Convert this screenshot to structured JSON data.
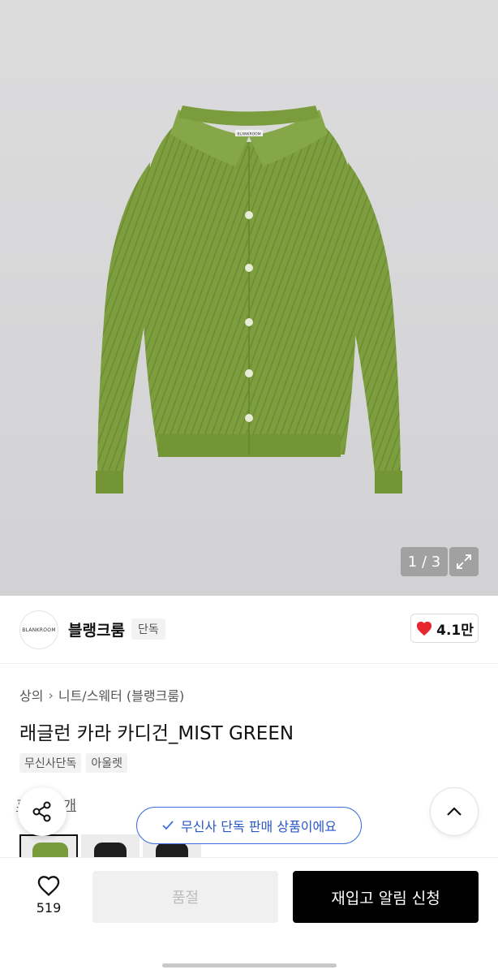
{
  "image_viewer": {
    "counter": "1 / 3",
    "expand_icon": "expand-arrows-icon",
    "garment_label": "BLANKROOM",
    "colors": {
      "background": "#d7d7d9",
      "garment": "#7a9b3c"
    }
  },
  "brand": {
    "logo_text": "BLANKROOM",
    "name": "블랭크룸",
    "tag": "단독",
    "likes": "4.1만",
    "like_icon": "heart-filled-icon",
    "like_color": "#e8262f"
  },
  "product": {
    "breadcrumb": [
      "상의",
      "니트/스웨터 (블랭크룸)"
    ],
    "title": "래글런 카라 카디건_MIST GREEN",
    "tags": [
      "무신사단독",
      "아울렛"
    ],
    "review_text": "후기 63개"
  },
  "floating": {
    "share_icon": "share-icon",
    "scroll_top_icon": "chevron-up-icon",
    "toast_icon": "check-icon",
    "toast_text": "무신사 단독 판매 상품이에요",
    "toast_color": "#3d6fe0"
  },
  "thumbnails": [
    {
      "label": "MIST GREEN",
      "color": "#7a9b3c"
    },
    {
      "label": "BLACK",
      "color": "#1e1e1e"
    },
    {
      "label": "BLACK",
      "color": "#1e1e1e"
    }
  ],
  "bottom_bar": {
    "wish_icon": "heart-outline-icon",
    "wish_count": "519",
    "soldout_label": "품절",
    "restock_label": "재입고 알림 신청"
  }
}
